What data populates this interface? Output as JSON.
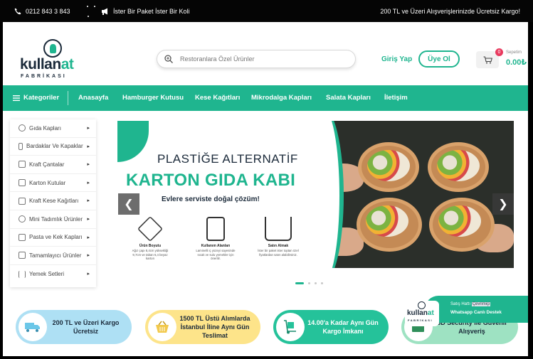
{
  "topbar": {
    "phone": "0212 843 3 843",
    "pack_slogan": "İster Bir Paket İster Bir Koli",
    "free_shipping": "200 TL ve Üzeri Alışverişlerinizde Ücretsiz Kargo!"
  },
  "header": {
    "logo_word_main": "kullan",
    "logo_word_accent": "at",
    "logo_sub": "FABRİKASI",
    "search_placeholder": "Restoranlara Özel Ürünler",
    "login_label": "Giriş Yap",
    "register_label": "Üye Ol",
    "cart_count": "0",
    "cart_label": "Sepetim",
    "cart_total": "0.00₺"
  },
  "nav": {
    "categories_label": "Kategoriler",
    "items": [
      "Anasayfa",
      "Hamburger Kutusu",
      "Kese Kağıtları",
      "Mikrodalga Kapları",
      "Salata Kapları",
      "İletişim"
    ]
  },
  "sidebar": {
    "items": [
      {
        "label": "Gıda Kapları",
        "icon": "food-container-icon"
      },
      {
        "label": "Bardaklar Ve Kapaklar",
        "icon": "cup-icon"
      },
      {
        "label": "Kraft Çantalar",
        "icon": "bag-icon"
      },
      {
        "label": "Karton Kutular",
        "icon": "box-icon"
      },
      {
        "label": "Kraft Kese Kağıtları",
        "icon": "paper-bag-icon"
      },
      {
        "label": "Mini Tadımlık Ürünler",
        "icon": "mini-cup-icon"
      },
      {
        "label": "Pasta ve Kek Kapları",
        "icon": "cake-icon"
      },
      {
        "label": "Tamamlayıcı Ürünler",
        "icon": "cutlery-icon"
      },
      {
        "label": "Yemek Setleri",
        "icon": "meal-set-icon"
      }
    ]
  },
  "banner": {
    "title_line1": "PLASTİĞE ALTERNATİF",
    "title_line2": "KARTON GIDA KABI",
    "subtitle": "Evlere serviste doğal çözüm!",
    "features": [
      {
        "title": "Ürün Boyutu",
        "desc": "Ağız çapı 8,4cm yüksekliği 9,7cm ve taban 6,4 beyaz karton"
      },
      {
        "title": "Kullanım Alanları",
        "desc": "Laminelli iç yüzeyi sayesinde sıcak ve sulu yemekler için önerilir."
      },
      {
        "title": "Satın Almak",
        "desc": "İster bir paket ister toptan özel fiyatlardan satın alabilirsiniz."
      }
    ],
    "slides_total": 4,
    "active_slide": 1
  },
  "pills": [
    {
      "text": "200 TL ve Üzeri Kargo Ücretsiz",
      "icon": "truck-icon"
    },
    {
      "text": "1500 TL Üstü Alımlarda İstanbul İline Aynı Gün Teslimat",
      "icon": "basket-icon"
    },
    {
      "text": "14.00'a Kadar Aynı Gün Kargo İmkanı",
      "icon": "hand-truck-icon"
    },
    {
      "text": "3D Security ile Güvenli Alışveriş",
      "icon": "wallet-icon"
    }
  ],
  "whatsapp": {
    "line1_prefix": "Satış Hattı ",
    "line1_highlight": "Çevrimiçi",
    "line2": "Whatsapp Canlı Destek"
  },
  "colors": {
    "brand_green": "#1fb58f",
    "dark_navy": "#1b2a3a"
  }
}
